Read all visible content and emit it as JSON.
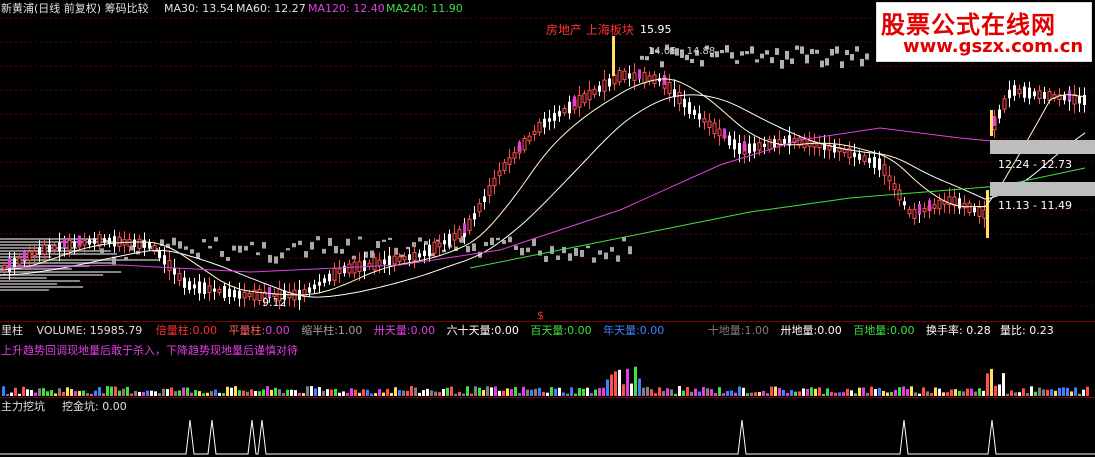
{
  "main_header": {
    "title": "新黄浦(日线 前复权) 筹码比较",
    "ma30": "MA30: 13.54",
    "ma60": "MA60: 12.27",
    "ma120": "MA120: 12.40",
    "ma240": "MA240: 11.90"
  },
  "annotations": {
    "news": "房地产 上海板块",
    "peak_price": "15.95",
    "peak_range": "14.05 - 14.88",
    "range_upper": "12.24 - 12.73",
    "range_lower": "11.13 - 11.49",
    "low_price": "9.12",
    "marker_s": "$"
  },
  "volume_header": {
    "label": "里柱",
    "volume": "VOLUME: 15985.79",
    "items": [
      {
        "label": "倍量柱:",
        "value": "0.00"
      },
      {
        "label": "平量柱:",
        "value": "0.00"
      },
      {
        "label": "缩半柱:",
        "value": "1.00"
      },
      {
        "label": "卅天量:",
        "value": "0.00"
      },
      {
        "label": "六十天量:",
        "value": "0.00"
      },
      {
        "label": "百天量:",
        "value": "0.00"
      },
      {
        "label": "年天量:",
        "value": "0.00"
      },
      {
        "label": "十地量:",
        "value": "1.00"
      },
      {
        "label": "卅地量:",
        "value": "0.00"
      },
      {
        "label": "百地量:",
        "value": "0.00"
      }
    ],
    "turnover": "换手率: 0.28",
    "ratio": "量比: 0.23",
    "hint": "上升趋势回调现地量后敢于杀入，下降趋势现地量后谨慎对待"
  },
  "indicator_header": {
    "label": "主力挖坑",
    "value": "挖金坑: 0.00"
  },
  "watermark": {
    "line1": "股票公式在线网",
    "line2": "www.gszx.com.cn"
  },
  "colors": {
    "background": "#000000",
    "up_candle": "#ff5050",
    "down_candle": "#ffffff",
    "ma30": "#ffffd0",
    "ma60": "#ffffff",
    "ma120": "#e040e0",
    "ma240": "#40e040",
    "grid": "#7a0000"
  }
}
